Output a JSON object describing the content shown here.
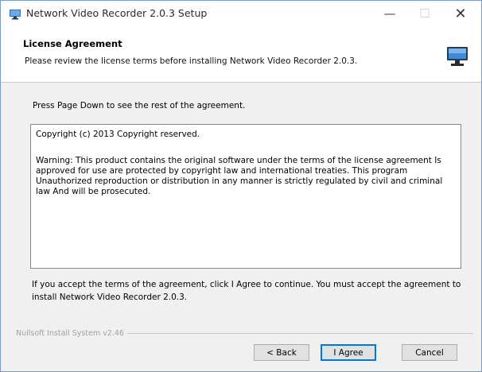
{
  "window": {
    "title": "Network Video Recorder 2.0.3 Setup",
    "minimize_glyph": "—",
    "maximize_glyph": "☐",
    "close_glyph": "✕"
  },
  "header": {
    "title": "License Agreement",
    "subtitle": "Please review the license terms before installing Network Video Recorder 2.0.3.",
    "icon": "monitor-icon"
  },
  "body": {
    "instructions": "Press Page Down to see the rest of the agreement.",
    "license_copyright": "Copyright (c) 2013 Copyright reserved.",
    "license_warning": "Warning: This product contains the original software under the terms of the license agreement Is approved for use are protected by copyright law and international treaties. This program Unauthorized reproduction or distribution in any manner is strictly regulated by civil and criminal law And will be prosecuted.",
    "accept_text": "If you accept the terms of the agreement, click I Agree to continue. You must accept the agreement to install Network Video Recorder 2.0.3."
  },
  "footer": {
    "branding": "Nullsoft Install System v2.46",
    "back_label": "< Back",
    "agree_label": "I Agree",
    "cancel_label": "Cancel"
  },
  "colors": {
    "accent": "#0078d7",
    "window_bg": "#f0f0f0",
    "header_bg": "#ffffff"
  }
}
